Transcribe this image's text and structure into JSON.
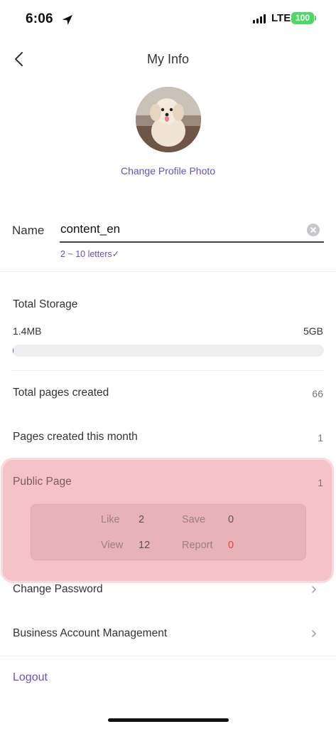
{
  "status_bar": {
    "time": "6:06",
    "network": "LTE",
    "battery": "100"
  },
  "header": {
    "title": "My Info"
  },
  "profile": {
    "change_photo_label": "Change Profile Photo"
  },
  "name_field": {
    "label": "Name",
    "value": "content_en",
    "hint": "2 ~ 10 letters✓"
  },
  "storage": {
    "label": "Total Storage",
    "used": "1.4MB",
    "max": "5GB",
    "used_fraction": 0.0003
  },
  "stats": {
    "total_pages_label": "Total pages created",
    "total_pages_value": "66",
    "month_pages_label": "Pages created this month",
    "month_pages_value": "1",
    "public_page_label": "Public Page",
    "public_page_value": "1"
  },
  "public_stats": {
    "like_label": "Like",
    "like_value": "2",
    "save_label": "Save",
    "save_value": "0",
    "view_label": "View",
    "view_value": "12",
    "report_label": "Report",
    "report_value": "0"
  },
  "menu": {
    "change_password": "Change Password",
    "business_account": "Business Account Management",
    "logout": "Logout"
  },
  "colors": {
    "accent": "#6a4fbf",
    "report": "#e8423b",
    "highlight": "#ec8c92"
  }
}
